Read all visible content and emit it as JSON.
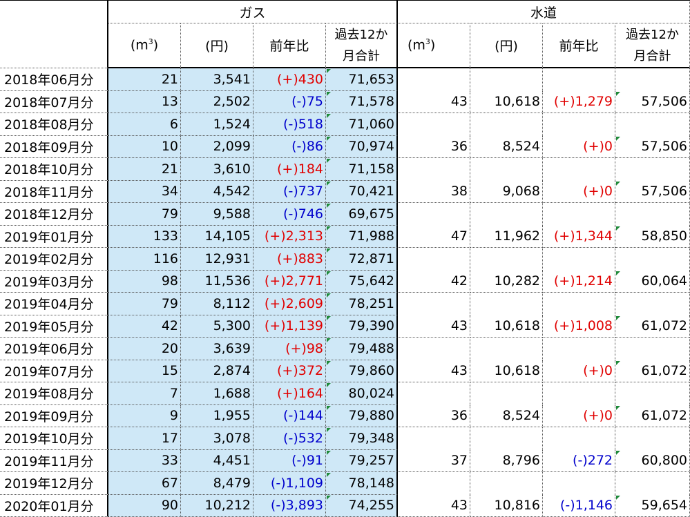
{
  "header": {
    "gas_title": "ガス",
    "water_title": "水道",
    "col_m3": "(m",
    "col_m3_sup": "3",
    "col_m3_close": ")",
    "col_yen": "(円)",
    "col_yoy": "前年比",
    "col_12m_line1": "過去12か",
    "col_12m_line2": "月合計"
  },
  "rows": [
    {
      "month": "2018年06月分",
      "gas_m3": "21",
      "gas_yen": "3,541",
      "gas_yoy": "(+)430",
      "gas_yoy_sign": "pos",
      "gas_12m": "71,653",
      "w_m3": "",
      "w_yen": "",
      "w_yoy": "",
      "w_yoy_sign": "",
      "w_12m": ""
    },
    {
      "month": "2018年07月分",
      "gas_m3": "13",
      "gas_yen": "2,502",
      "gas_yoy": "(-)75",
      "gas_yoy_sign": "neg",
      "gas_12m": "71,578",
      "w_m3": "43",
      "w_yen": "10,618",
      "w_yoy": "(+)1,279",
      "w_yoy_sign": "pos",
      "w_12m": "57,506"
    },
    {
      "month": "2018年08月分",
      "gas_m3": "6",
      "gas_yen": "1,524",
      "gas_yoy": "(-)518",
      "gas_yoy_sign": "neg",
      "gas_12m": "71,060",
      "w_m3": "",
      "w_yen": "",
      "w_yoy": "",
      "w_yoy_sign": "",
      "w_12m": ""
    },
    {
      "month": "2018年09月分",
      "gas_m3": "10",
      "gas_yen": "2,099",
      "gas_yoy": "(-)86",
      "gas_yoy_sign": "neg",
      "gas_12m": "70,974",
      "w_m3": "36",
      "w_yen": "8,524",
      "w_yoy": "(+)0",
      "w_yoy_sign": "pos",
      "w_12m": "57,506"
    },
    {
      "month": "2018年10月分",
      "gas_m3": "21",
      "gas_yen": "3,610",
      "gas_yoy": "(+)184",
      "gas_yoy_sign": "pos",
      "gas_12m": "71,158",
      "w_m3": "",
      "w_yen": "",
      "w_yoy": "",
      "w_yoy_sign": "",
      "w_12m": ""
    },
    {
      "month": "2018年11月分",
      "gas_m3": "34",
      "gas_yen": "4,542",
      "gas_yoy": "(-)737",
      "gas_yoy_sign": "neg",
      "gas_12m": "70,421",
      "w_m3": "38",
      "w_yen": "9,068",
      "w_yoy": "(+)0",
      "w_yoy_sign": "pos",
      "w_12m": "57,506"
    },
    {
      "month": "2018年12月分",
      "gas_m3": "79",
      "gas_yen": "9,588",
      "gas_yoy": "(-)746",
      "gas_yoy_sign": "neg",
      "gas_12m": "69,675",
      "w_m3": "",
      "w_yen": "",
      "w_yoy": "",
      "w_yoy_sign": "",
      "w_12m": ""
    },
    {
      "month": "2019年01月分",
      "gas_m3": "133",
      "gas_yen": "14,105",
      "gas_yoy": "(+)2,313",
      "gas_yoy_sign": "pos",
      "gas_12m": "71,988",
      "w_m3": "47",
      "w_yen": "11,962",
      "w_yoy": "(+)1,344",
      "w_yoy_sign": "pos",
      "w_12m": "58,850"
    },
    {
      "month": "2019年02月分",
      "gas_m3": "116",
      "gas_yen": "12,931",
      "gas_yoy": "(+)883",
      "gas_yoy_sign": "pos",
      "gas_12m": "72,871",
      "w_m3": "",
      "w_yen": "",
      "w_yoy": "",
      "w_yoy_sign": "",
      "w_12m": ""
    },
    {
      "month": "2019年03月分",
      "gas_m3": "98",
      "gas_yen": "11,536",
      "gas_yoy": "(+)2,771",
      "gas_yoy_sign": "pos",
      "gas_12m": "75,642",
      "w_m3": "42",
      "w_yen": "10,282",
      "w_yoy": "(+)1,214",
      "w_yoy_sign": "pos",
      "w_12m": "60,064"
    },
    {
      "month": "2019年04月分",
      "gas_m3": "79",
      "gas_yen": "8,112",
      "gas_yoy": "(+)2,609",
      "gas_yoy_sign": "pos",
      "gas_12m": "78,251",
      "w_m3": "",
      "w_yen": "",
      "w_yoy": "",
      "w_yoy_sign": "",
      "w_12m": ""
    },
    {
      "month": "2019年05月分",
      "gas_m3": "42",
      "gas_yen": "5,300",
      "gas_yoy": "(+)1,139",
      "gas_yoy_sign": "pos",
      "gas_12m": "79,390",
      "w_m3": "43",
      "w_yen": "10,618",
      "w_yoy": "(+)1,008",
      "w_yoy_sign": "pos",
      "w_12m": "61,072"
    },
    {
      "month": "2019年06月分",
      "gas_m3": "20",
      "gas_yen": "3,639",
      "gas_yoy": "(+)98",
      "gas_yoy_sign": "pos",
      "gas_12m": "79,488",
      "w_m3": "",
      "w_yen": "",
      "w_yoy": "",
      "w_yoy_sign": "",
      "w_12m": ""
    },
    {
      "month": "2019年07月分",
      "gas_m3": "15",
      "gas_yen": "2,874",
      "gas_yoy": "(+)372",
      "gas_yoy_sign": "pos",
      "gas_12m": "79,860",
      "w_m3": "43",
      "w_yen": "10,618",
      "w_yoy": "(+)0",
      "w_yoy_sign": "pos",
      "w_12m": "61,072"
    },
    {
      "month": "2019年08月分",
      "gas_m3": "7",
      "gas_yen": "1,688",
      "gas_yoy": "(+)164",
      "gas_yoy_sign": "pos",
      "gas_12m": "80,024",
      "w_m3": "",
      "w_yen": "",
      "w_yoy": "",
      "w_yoy_sign": "",
      "w_12m": ""
    },
    {
      "month": "2019年09月分",
      "gas_m3": "9",
      "gas_yen": "1,955",
      "gas_yoy": "(-)144",
      "gas_yoy_sign": "neg",
      "gas_12m": "79,880",
      "w_m3": "36",
      "w_yen": "8,524",
      "w_yoy": "(+)0",
      "w_yoy_sign": "pos",
      "w_12m": "61,072"
    },
    {
      "month": "2019年10月分",
      "gas_m3": "17",
      "gas_yen": "3,078",
      "gas_yoy": "(-)532",
      "gas_yoy_sign": "neg",
      "gas_12m": "79,348",
      "w_m3": "",
      "w_yen": "",
      "w_yoy": "",
      "w_yoy_sign": "",
      "w_12m": ""
    },
    {
      "month": "2019年11月分",
      "gas_m3": "33",
      "gas_yen": "4,451",
      "gas_yoy": "(-)91",
      "gas_yoy_sign": "neg",
      "gas_12m": "79,257",
      "w_m3": "37",
      "w_yen": "8,796",
      "w_yoy": "(-)272",
      "w_yoy_sign": "neg",
      "w_12m": "60,800"
    },
    {
      "month": "2019年12月分",
      "gas_m3": "67",
      "gas_yen": "8,479",
      "gas_yoy": "(-)1,109",
      "gas_yoy_sign": "neg",
      "gas_12m": "78,148",
      "w_m3": "",
      "w_yen": "",
      "w_yoy": "",
      "w_yoy_sign": "",
      "w_12m": ""
    },
    {
      "month": "2020年01月分",
      "gas_m3": "90",
      "gas_yen": "10,212",
      "gas_yoy": "(-)3,893",
      "gas_yoy_sign": "neg",
      "gas_12m": "74,255",
      "w_m3": "43",
      "w_yen": "10,816",
      "w_yoy": "(-)1,146",
      "w_yoy_sign": "neg",
      "w_12m": "59,654"
    }
  ]
}
